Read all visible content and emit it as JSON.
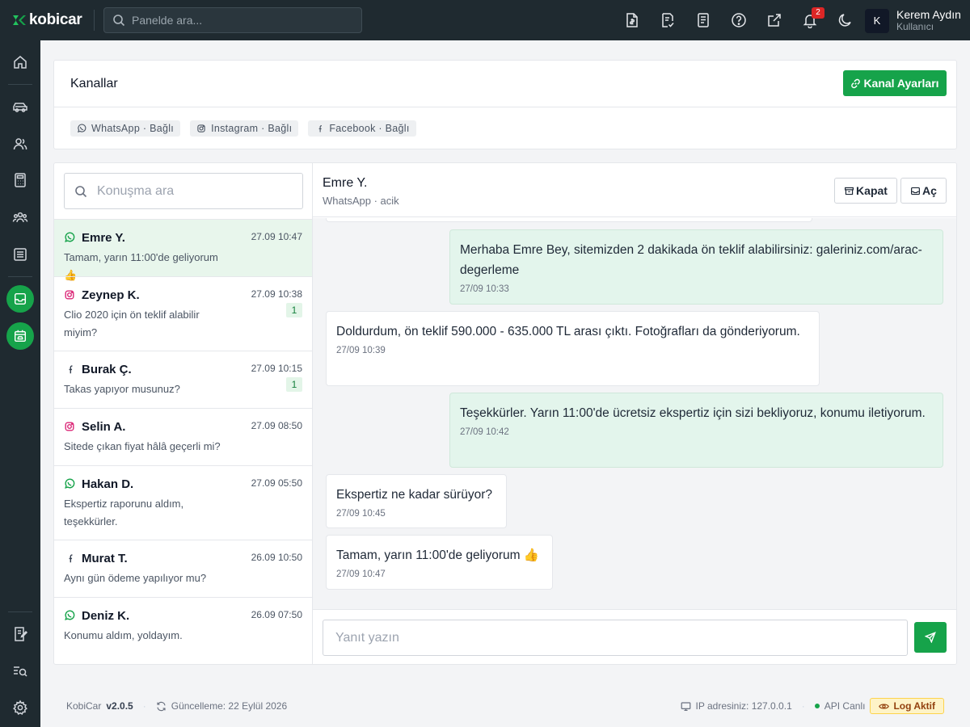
{
  "topbar": {
    "logo_text": "kobicar",
    "search_placeholder": "Panelde ara...",
    "notification_count": "2",
    "user": {
      "initial": "K",
      "name": "Kerem Aydın",
      "role": "Kullanıcı"
    }
  },
  "channels": {
    "title": "Kanallar",
    "settings_button": "Kanal Ayarları",
    "items": [
      {
        "label": "WhatsApp · Bağlı",
        "icon": "whatsapp-icon"
      },
      {
        "label": "Instagram · Bağlı",
        "icon": "instagram-icon"
      },
      {
        "label": "Facebook · Bağlı",
        "icon": "facebook-icon"
      }
    ]
  },
  "conversations": {
    "search_placeholder": "Konuşma ara",
    "items": [
      {
        "name": "Emre Y.",
        "time": "27.09 10:47",
        "preview": "Tamam, yarın 11:00'de geliyorum 👍",
        "channel": "whatsapp",
        "unread": ""
      },
      {
        "name": "Zeynep K.",
        "time": "27.09 10:38",
        "preview": "Clio 2020 için ön teklif alabilir miyim?",
        "channel": "instagram",
        "unread": "1"
      },
      {
        "name": "Burak Ç.",
        "time": "27.09 10:15",
        "preview": "Takas yapıyor musunuz?",
        "channel": "facebook",
        "unread": "1"
      },
      {
        "name": "Selin A.",
        "time": "27.09 08:50",
        "preview": "Sitede çıkan fiyat hâlâ geçerli mi?",
        "channel": "instagram",
        "unread": ""
      },
      {
        "name": "Hakan D.",
        "time": "27.09 05:50",
        "preview": "Ekspertiz raporunu aldım, teşekkürler.",
        "channel": "whatsapp",
        "unread": ""
      },
      {
        "name": "Murat T.",
        "time": "26.09 10:50",
        "preview": "Aynı gün ödeme yapılıyor mu?",
        "channel": "facebook",
        "unread": ""
      },
      {
        "name": "Deniz K.",
        "time": "26.09 07:50",
        "preview": "Konumu aldım, yoldayım.",
        "channel": "whatsapp",
        "unread": ""
      }
    ]
  },
  "chat": {
    "name": "Emre Y.",
    "subtitle": "WhatsApp · acik",
    "close_button": "Kapat",
    "open_button": "Aç",
    "messages": [
      {
        "direction": "out",
        "text": "Merhaba Emre Bey, sitemizden 2 dakikada ön teklif alabilirsiniz: galeriniz.com/arac-degerleme",
        "time": "27/09 10:33"
      },
      {
        "direction": "in",
        "text": "Doldurdum, ön teklif 590.000 - 635.000 TL arası çıktı. Fotoğrafları da gönderiyorum.",
        "time": "27/09 10:39"
      },
      {
        "direction": "out",
        "text": "Teşekkürler. Yarın 11:00'de ücretsiz ekspertiz için sizi bekliyoruz, konumu iletiyorum.",
        "time": "27/09 10:42"
      },
      {
        "direction": "in",
        "text": "Ekspertiz ne kadar sürüyor?",
        "time": "27/09 10:45"
      },
      {
        "direction": "in",
        "text": "Tamam, yarın 11:00'de geliyorum 👍",
        "time": "27/09 10:47"
      }
    ],
    "reply_placeholder": "Yanıt yazın"
  },
  "footer": {
    "app_name": "KobiCar",
    "version": "v2.0.5",
    "update_text": "Güncelleme: 22 Eylül 2026",
    "ip_text": "IP adresiniz: 127.0.0.1",
    "api_status": "API Canlı",
    "log_status": "Log Aktif"
  },
  "colors": {
    "sidebar_bg": "#1f2a30",
    "accent_green": "#16a34a",
    "outgoing_bubble": "#e3f5ec",
    "active_row": "#e8f6ec",
    "badge_red": "#dc2626"
  }
}
